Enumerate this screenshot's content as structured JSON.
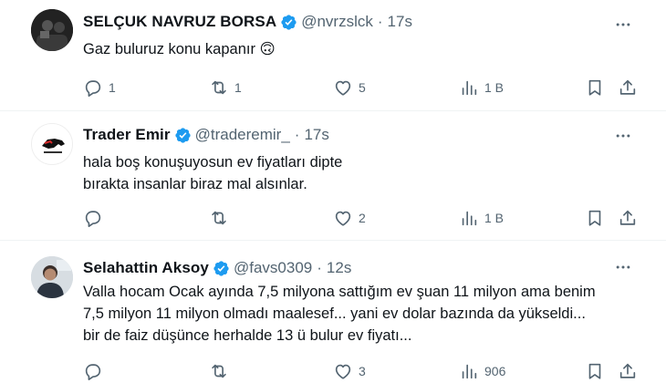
{
  "tweets": [
    {
      "name": "SELÇUK NAVRUZ BORSA",
      "handle": "@nvrzslck",
      "time": "17s",
      "text_lines": [
        "Gaz buluruz konu kapanır 🙃"
      ],
      "reply_count": "1",
      "retweet_count": "1",
      "like_count": "5",
      "view_count": "1 B"
    },
    {
      "name": "Trader Emir",
      "handle": "@traderemir_",
      "time": "17s",
      "text_lines": [
        "hala boş konuşuyosun ev fiyatları dipte",
        "bırakta insanlar biraz mal alsınlar."
      ],
      "reply_count": "",
      "retweet_count": "",
      "like_count": "2",
      "view_count": "1 B"
    },
    {
      "name": "Selahattin Aksoy",
      "handle": "@favs0309",
      "time": "12s",
      "text_lines": [
        "Valla hocam Ocak ayında 7,5 milyona sattığım ev şuan 11 milyon ama benim",
        "7,5 milyon 11 milyon olmadı maalesef... yani ev dolar bazında da yükseldi...",
        "bir de faiz düşünce herhalde 13 ü bulur ev fiyatı..."
      ],
      "reply_count": "",
      "retweet_count": "",
      "like_count": "3",
      "view_count": "906"
    }
  ],
  "colors": {
    "verified": "#1d9bf0",
    "muted": "#536471",
    "text": "#0f1419",
    "separator": "#eff3f4"
  },
  "icons": [
    "verified-badge-icon",
    "more-icon",
    "reply-icon",
    "retweet-icon",
    "like-icon",
    "views-icon",
    "bookmark-icon",
    "share-icon"
  ]
}
